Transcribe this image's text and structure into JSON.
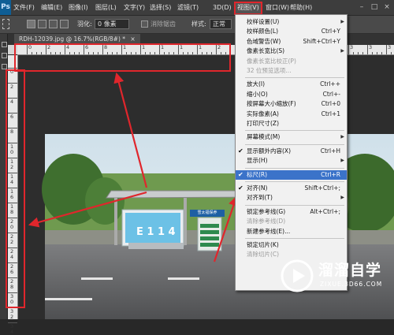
{
  "menubar": {
    "logo": "Ps",
    "items": [
      {
        "label": "文件(F)"
      },
      {
        "label": "编辑(E)"
      },
      {
        "label": "图像(I)"
      },
      {
        "label": "图层(L)"
      },
      {
        "label": "文字(Y)"
      },
      {
        "label": "选择(S)"
      },
      {
        "label": "滤镜(T)"
      },
      {
        "label": "3D(D)"
      },
      {
        "label": "视图(V)",
        "active": true
      },
      {
        "label": "窗口(W)"
      },
      {
        "label": "帮助(H)"
      }
    ]
  },
  "options_bar": {
    "feather_label": "羽化:",
    "feather_value": "0 像素",
    "antialias_label": "消除锯齿",
    "style_label": "样式:",
    "style_value": "正常"
  },
  "document_tab": {
    "title": "RDH-12039.jpg @ 16.7%(RGB/8#) *",
    "close": "×"
  },
  "rulers": {
    "horizontal_labels": [
      "0",
      "2",
      "4",
      "6",
      "8",
      "1",
      "1",
      "1",
      "1",
      "1",
      "2",
      "2",
      "2",
      "2",
      "2",
      "3",
      "3",
      "3",
      "3",
      "3"
    ],
    "vertical_labels": [
      "0",
      "2",
      "4",
      "6",
      "8",
      "1 0",
      "1 2",
      "1 4",
      "1 6",
      "1 8",
      "2 0",
      "2 2",
      "2 4",
      "2 6",
      "2 8",
      "3 0",
      "3 2",
      "3 4"
    ]
  },
  "view_menu": {
    "items": [
      {
        "label": "校样设置(U)",
        "submenu": true
      },
      {
        "label": "校样颜色(L)",
        "shortcut": "Ctrl+Y"
      },
      {
        "label": "色域警告(W)",
        "shortcut": "Shift+Ctrl+Y"
      },
      {
        "label": "像素长宽比(S)",
        "submenu": true
      },
      {
        "label": "像素长宽比校正(P)",
        "disabled": true
      },
      {
        "label": "32 位预览选项...",
        "disabled": true
      },
      {
        "separator": true
      },
      {
        "label": "放大(I)",
        "shortcut": "Ctrl++"
      },
      {
        "label": "缩小(O)",
        "shortcut": "Ctrl+-"
      },
      {
        "label": "按屏幕大小缩放(F)",
        "shortcut": "Ctrl+0"
      },
      {
        "label": "实际像素(A)",
        "shortcut": "Ctrl+1"
      },
      {
        "label": "打印尺寸(Z)"
      },
      {
        "separator": true
      },
      {
        "label": "屏幕模式(M)",
        "submenu": true
      },
      {
        "separator": true
      },
      {
        "label": "显示额外内容(X)",
        "shortcut": "Ctrl+H",
        "checked": true
      },
      {
        "label": "显示(H)",
        "submenu": true
      },
      {
        "separator": true
      },
      {
        "label": "标尺(R)",
        "shortcut": "Ctrl+R",
        "checked": true,
        "highlighted": true
      },
      {
        "separator": true
      },
      {
        "label": "对齐(N)",
        "shortcut": "Shift+Ctrl+;",
        "checked": true
      },
      {
        "label": "对齐到(T)",
        "submenu": true
      },
      {
        "separator": true
      },
      {
        "label": "锁定参考线(G)",
        "shortcut": "Alt+Ctrl+;"
      },
      {
        "label": "清除参考线(D)",
        "disabled": true
      },
      {
        "label": "新建参考线(E)..."
      },
      {
        "separator": true
      },
      {
        "label": "锁定切片(K)"
      },
      {
        "label": "清除切片(C)",
        "disabled": true
      }
    ]
  },
  "billboard": {
    "sign_text": "雪太福保养"
  },
  "watermark": {
    "brand": "溜溜自学",
    "url": "ZIXUE.3D66.COM"
  },
  "colors": {
    "highlight": "#3b73c9",
    "annotation_red": "#e0262c"
  }
}
